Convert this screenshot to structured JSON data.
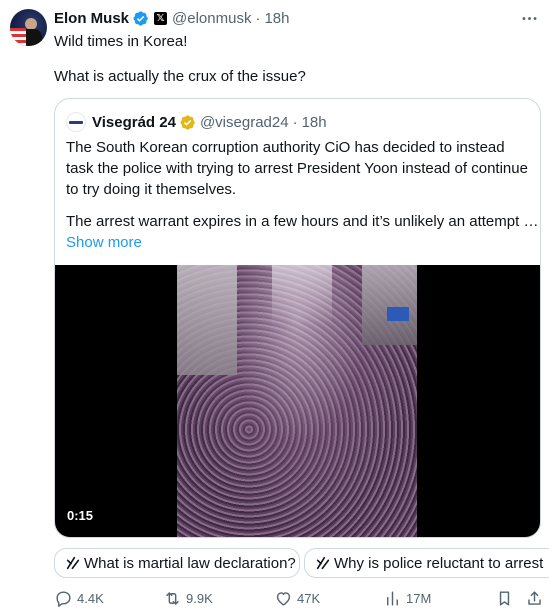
{
  "tweet": {
    "author_name": "Elon Musk",
    "handle": "@elonmusk",
    "separator": "·",
    "time": "18h",
    "more_icon": "more-horizontal-icon",
    "text_line1": "Wild times in Korea!",
    "text_line2": "What is actually the crux of the issue?"
  },
  "quote": {
    "author_name": "Visegrád 24",
    "handle": "@visegrad24",
    "separator": "·",
    "time": "18h",
    "text_para1": "The South Korean corruption authority CiO has decided to instead task the police with trying to arrest President Yoon instead of continue to try doing it themselves.",
    "text_para2": "The arrest warrant expires in a few hours and it’s unlikely an attempt …",
    "show_more": "Show more",
    "video_duration": "0:15"
  },
  "suggestions": [
    {
      "label": "What is martial law declaration?"
    },
    {
      "label": "Why is police reluctant to arrest"
    }
  ],
  "actions": {
    "replies": "4.4K",
    "reposts": "9.9K",
    "likes": "47K",
    "views": "17M"
  },
  "colors": {
    "accent": "#1d9bf0",
    "verified_blue": "#1d9bf0",
    "verified_gold": "#e2b719",
    "muted": "#536471",
    "border": "#cfd9de"
  }
}
